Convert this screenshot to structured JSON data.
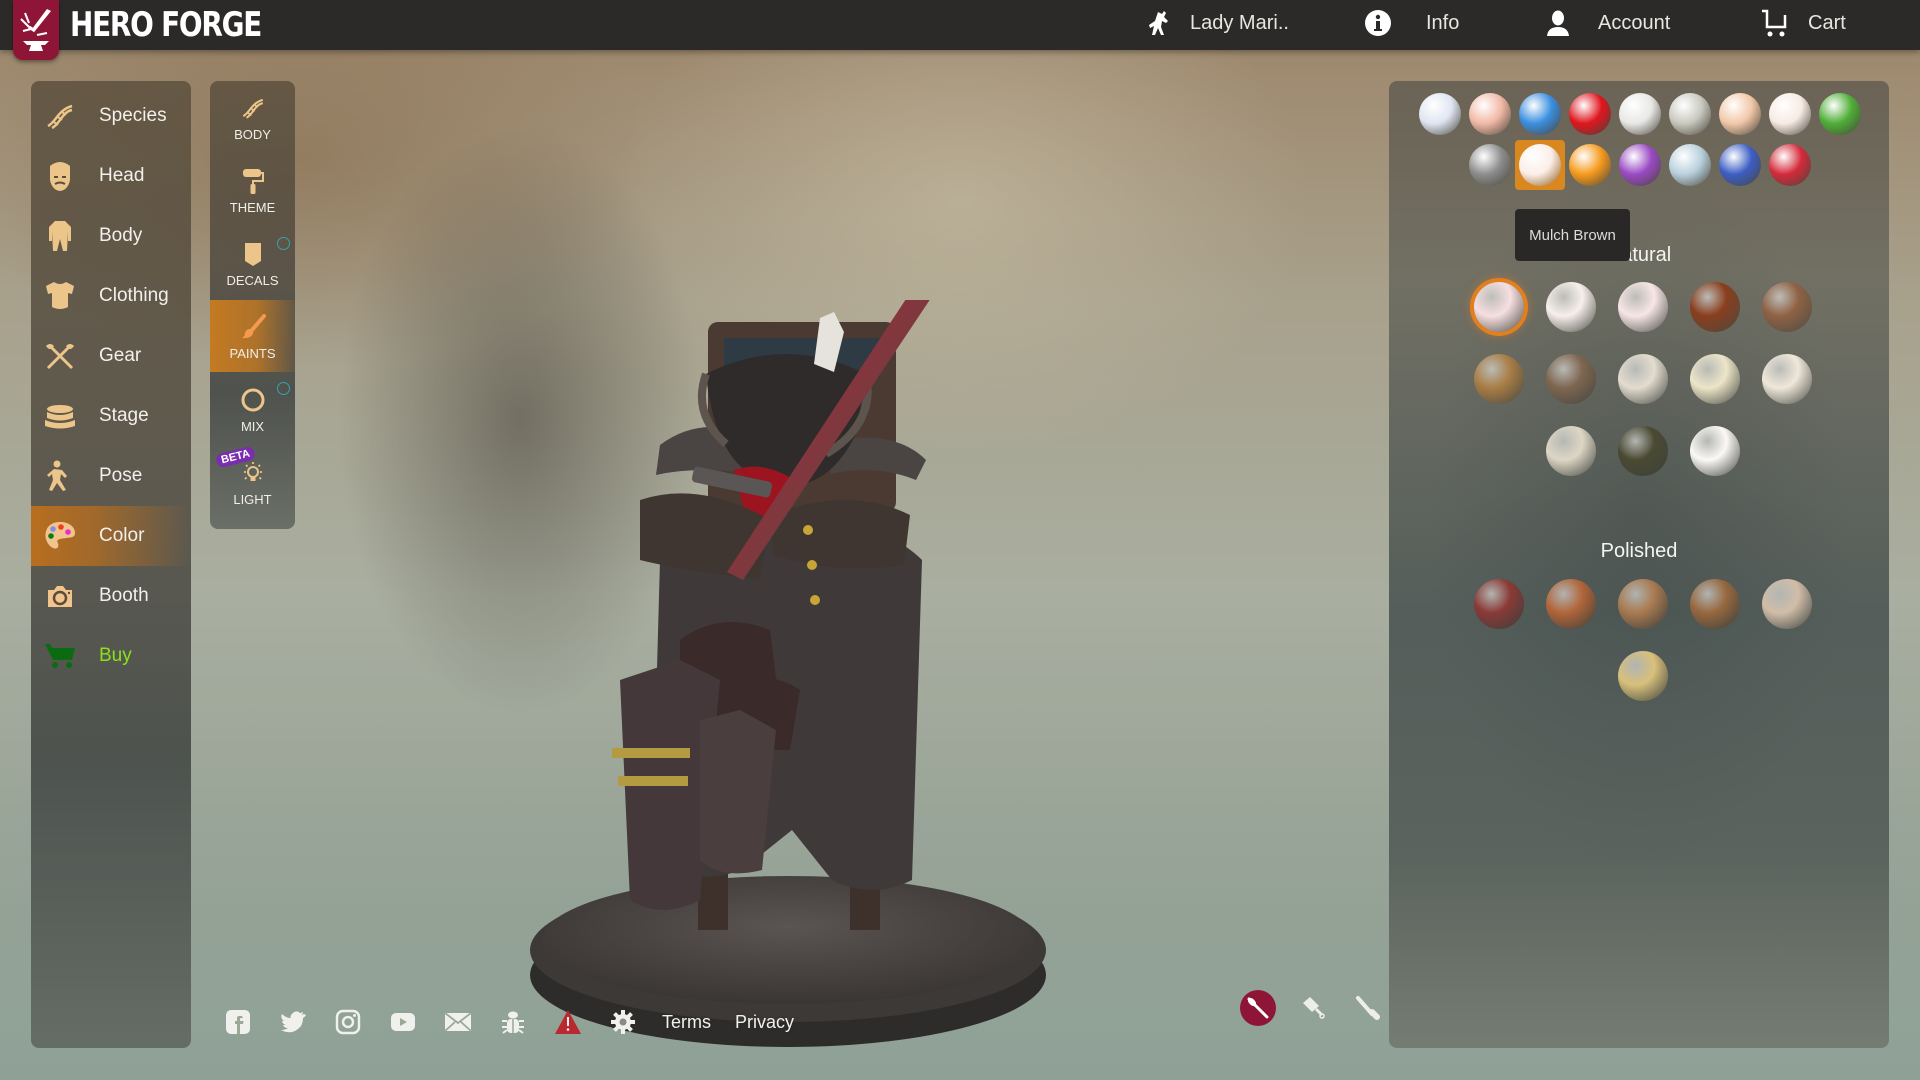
{
  "header": {
    "brand": "HERO FORGE",
    "nav": [
      {
        "label": "Lady Mari..",
        "icon": "hero-figure-icon"
      },
      {
        "label": "Info",
        "icon": "info-icon"
      },
      {
        "label": "Account",
        "icon": "account-icon"
      },
      {
        "label": "Cart",
        "icon": "cart-icon"
      }
    ]
  },
  "main_menu": [
    {
      "label": "Species",
      "icon": "dna-icon"
    },
    {
      "label": "Head",
      "icon": "head-icon"
    },
    {
      "label": "Body",
      "icon": "body-icon"
    },
    {
      "label": "Clothing",
      "icon": "clothing-icon"
    },
    {
      "label": "Gear",
      "icon": "crossed-axes-icon"
    },
    {
      "label": "Stage",
      "icon": "stage-base-icon"
    },
    {
      "label": "Pose",
      "icon": "pose-icon"
    },
    {
      "label": "Color",
      "icon": "palette-icon",
      "active": true
    },
    {
      "label": "Booth",
      "icon": "camera-icon"
    },
    {
      "label": "Buy",
      "icon": "shopping-cart-icon"
    }
  ],
  "sub_menu": [
    {
      "label": "BODY",
      "icon": "dna-icon"
    },
    {
      "label": "THEME",
      "icon": "paint-roller-icon"
    },
    {
      "label": "DECALS",
      "icon": "decal-icon",
      "indicator": true
    },
    {
      "label": "PAINTS",
      "icon": "paintbrush-icon",
      "active": true
    },
    {
      "label": "MIX",
      "icon": "mix-ring-icon",
      "indicator": true
    },
    {
      "label": "LIGHT",
      "icon": "lightbulb-icon",
      "badge": "BETA"
    }
  ],
  "paint_categories": [
    {
      "name": "fabric",
      "color": "#dfe6f2"
    },
    {
      "name": "skin",
      "color": "#f1b9a6"
    },
    {
      "name": "water",
      "color": "#3b8fe0"
    },
    {
      "name": "dice",
      "color": "#e0161e"
    },
    {
      "name": "metal-silver",
      "color": "#e8e8e6"
    },
    {
      "name": "bone",
      "color": "#c9c9c0"
    },
    {
      "name": "wood",
      "color": "#f2c8a8"
    },
    {
      "name": "hair",
      "color": "#f7ebe4"
    },
    {
      "name": "plant",
      "color": "#4fae37"
    },
    {
      "name": "stone",
      "color": "#8d8d8d"
    },
    {
      "name": "hair-selected",
      "color": "#fbeee8",
      "selected": true
    },
    {
      "name": "fire",
      "color": "#f59a1c"
    },
    {
      "name": "gem",
      "color": "#9a49c4"
    },
    {
      "name": "glass",
      "color": "#b8d0dc"
    },
    {
      "name": "eye",
      "color": "#3c5ec4"
    },
    {
      "name": "potions",
      "color": "#d42a3a"
    }
  ],
  "tooltip": "Mulch Brown",
  "sections": [
    {
      "title": "Natural",
      "swatches": [
        {
          "color": "#f6dfe0",
          "selected": true
        },
        {
          "color": "#f7efeb"
        },
        {
          "color": "#f7e6e6"
        },
        {
          "color": "#8a3e1e"
        },
        {
          "color": "#8f6244"
        },
        {
          "color": "#a97d45"
        },
        {
          "color": "#7e6650"
        },
        {
          "color": "#e3dccf"
        },
        {
          "color": "#ece5c8"
        },
        {
          "color": "#efe8da"
        },
        {
          "color": "#ddd6c4"
        },
        {
          "color": "#4a4a32"
        },
        {
          "color": "#fbf8f5"
        }
      ]
    },
    {
      "title": "Polished",
      "swatches": [
        {
          "color": "#8a3a36"
        },
        {
          "color": "#b2653a"
        },
        {
          "color": "#a97a50"
        },
        {
          "color": "#97683f"
        },
        {
          "color": "#d1bda8"
        },
        {
          "color": "#d9c07a"
        }
      ]
    }
  ],
  "footer": {
    "icons": [
      "facebook-icon",
      "twitter-icon",
      "instagram-icon",
      "youtube-icon",
      "mail-icon",
      "bug-icon",
      "warning-icon",
      "settings-icon"
    ],
    "links": [
      "Terms",
      "Privacy"
    ]
  },
  "tools": [
    {
      "name": "paintbrush-tool",
      "active": true
    },
    {
      "name": "bucket-tool"
    },
    {
      "name": "eyedropper-tool"
    }
  ],
  "colors": {
    "accent_orange": "#d98820",
    "brand_red": "#8e1535",
    "buy_green": "#8be21a",
    "icon_tan": "#ecc58a",
    "indicator_teal": "#3aa0b0"
  }
}
